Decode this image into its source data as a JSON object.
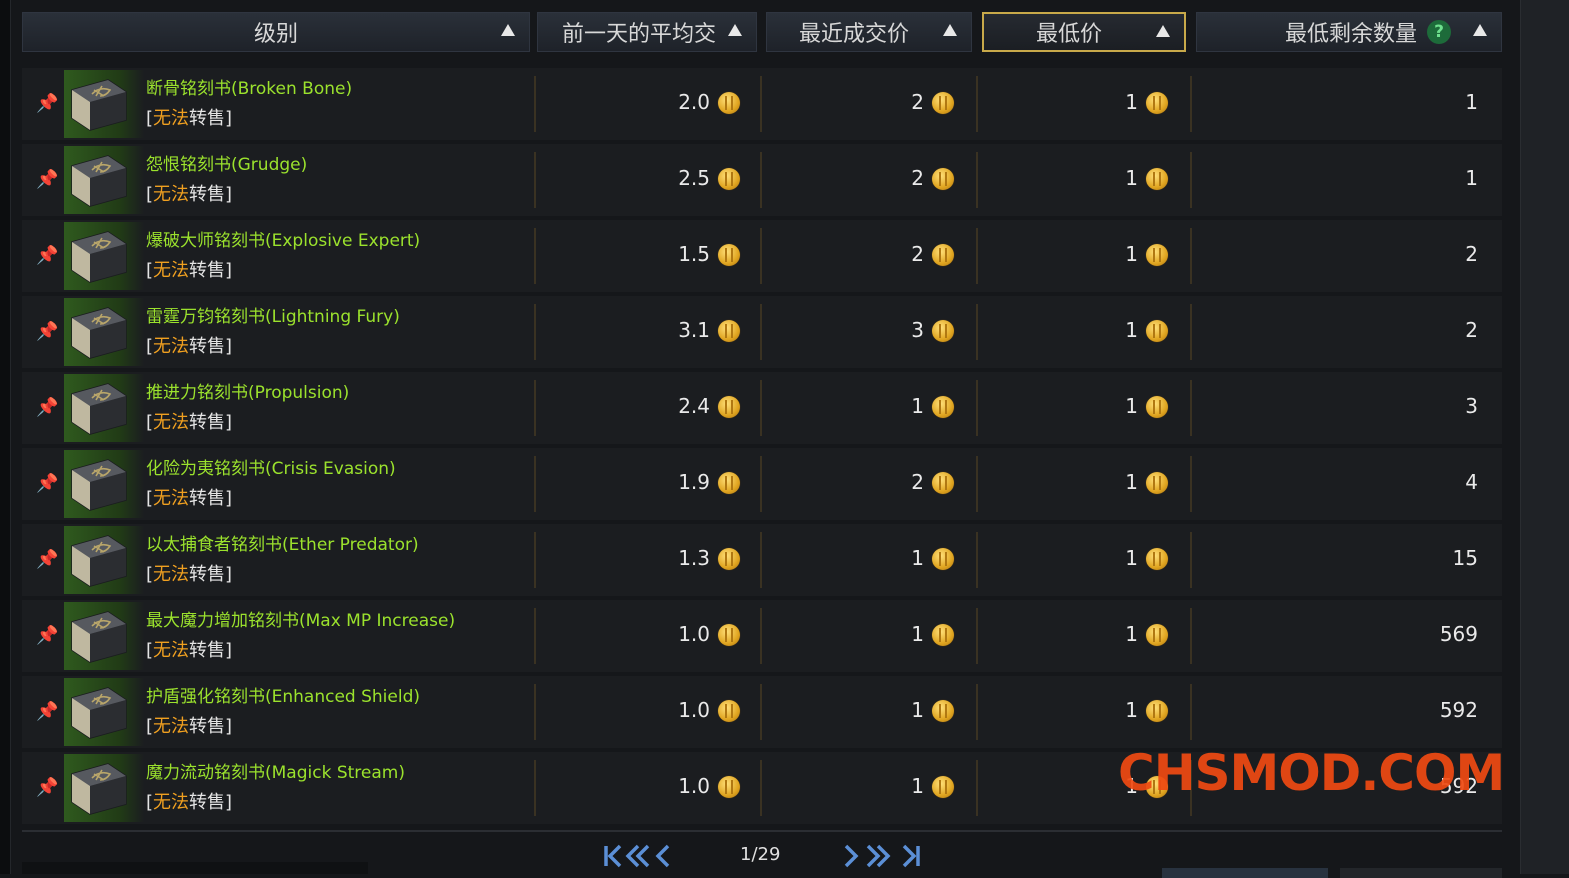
{
  "header": {
    "col_grade": "级别",
    "col_avg": "前一天的平均交",
    "col_recent": "最近成交价",
    "col_lowest": "最低价",
    "col_min_qty": "最低剩余数量",
    "help_glyph": "?"
  },
  "trade_tag": {
    "open": "[",
    "blocked": "无法",
    "rest": "转售",
    "close": "]"
  },
  "items": [
    {
      "name": "断骨铭刻书(Broken Bone)",
      "avg": "2.0",
      "recent": "2",
      "lowest": "1",
      "min_qty": "1"
    },
    {
      "name": "怨恨铭刻书(Grudge)",
      "avg": "2.5",
      "recent": "2",
      "lowest": "1",
      "min_qty": "1"
    },
    {
      "name": "爆破大师铭刻书(Explosive Expert)",
      "avg": "1.5",
      "recent": "2",
      "lowest": "1",
      "min_qty": "2"
    },
    {
      "name": "雷霆万钧铭刻书(Lightning Fury)",
      "avg": "3.1",
      "recent": "3",
      "lowest": "1",
      "min_qty": "2"
    },
    {
      "name": "推进力铭刻书(Propulsion)",
      "avg": "2.4",
      "recent": "1",
      "lowest": "1",
      "min_qty": "3"
    },
    {
      "name": "化险为夷铭刻书(Crisis Evasion)",
      "avg": "1.9",
      "recent": "2",
      "lowest": "1",
      "min_qty": "4"
    },
    {
      "name": "以太捕食者铭刻书(Ether Predator)",
      "avg": "1.3",
      "recent": "1",
      "lowest": "1",
      "min_qty": "15"
    },
    {
      "name": "最大魔力增加铭刻书(Max MP Increase)",
      "avg": "1.0",
      "recent": "1",
      "lowest": "1",
      "min_qty": "569"
    },
    {
      "name": "护盾强化铭刻书(Enhanced Shield)",
      "avg": "1.0",
      "recent": "1",
      "lowest": "1",
      "min_qty": "592"
    },
    {
      "name": "魔力流动铭刻书(Magick Stream)",
      "avg": "1.0",
      "recent": "1",
      "lowest": "1",
      "min_qty": "592"
    }
  ],
  "pagination": {
    "page_text": "1/29"
  },
  "watermark": "CHSMOD.COM",
  "colors": {
    "item_name": "#9be22d",
    "blocked_text": "#f0a020",
    "active_border": "#c8a94a",
    "pager_arrows": "#5b8fd6",
    "watermark": "#f04a12"
  }
}
